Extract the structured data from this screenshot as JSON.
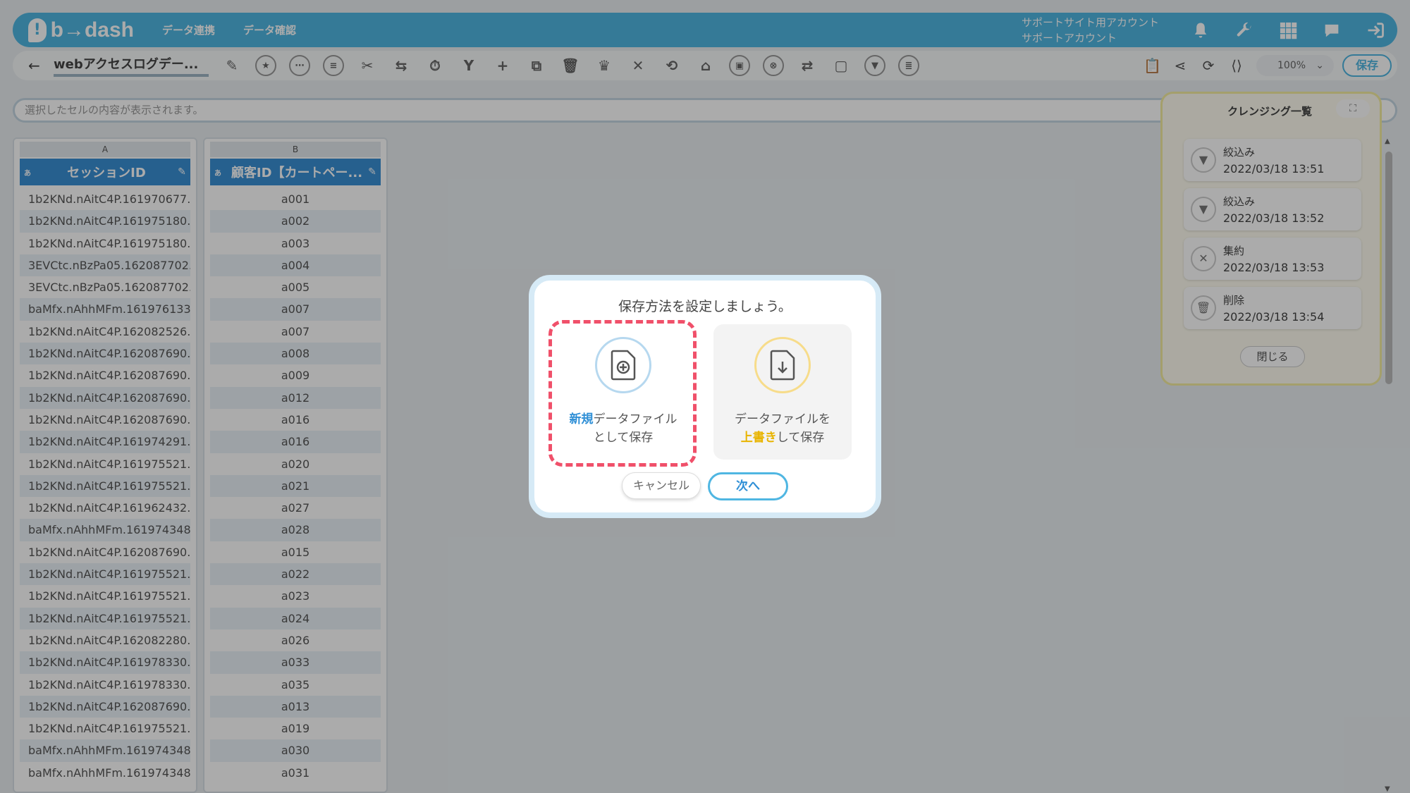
{
  "header": {
    "logo_mark": "!",
    "logo_text": "b→dash",
    "nav": [
      "データ連携",
      "データ確認"
    ],
    "account_line1": "サポートサイト用アカウント",
    "account_line2": "サポートアカウント"
  },
  "toolbar": {
    "back": "←",
    "title": "webアクセスログデー...",
    "zoom": "100%",
    "zoom_caret": "⌄",
    "save_label": "保存"
  },
  "cellbar": {
    "placeholder": "選択したセルの内容が表示されます。"
  },
  "grid": {
    "col_a": {
      "letter": "A",
      "type": "あ",
      "name": "セッションID"
    },
    "col_b": {
      "letter": "B",
      "type": "あ",
      "name": "顧客ID【カートペー..."
    },
    "rows_a": [
      "1b2KNd.nAitC4P.161970677...",
      "1b2KNd.nAitC4P.161975180...",
      "1b2KNd.nAitC4P.161975180...",
      "3EVCtc.nBzPa05.162087702...",
      "3EVCtc.nBzPa05.162087702...",
      "baMfx.nAhhMFm.161976133...",
      "1b2KNd.nAitC4P.162082526...",
      "1b2KNd.nAitC4P.162087690...",
      "1b2KNd.nAitC4P.162087690...",
      "1b2KNd.nAitC4P.162087690...",
      "1b2KNd.nAitC4P.162087690...",
      "1b2KNd.nAitC4P.161974291...",
      "1b2KNd.nAitC4P.161975521...",
      "1b2KNd.nAitC4P.161975521...",
      "1b2KNd.nAitC4P.161962432...",
      "baMfx.nAhhMFm.161974348...",
      "1b2KNd.nAitC4P.162087690...",
      "1b2KNd.nAitC4P.161975521...",
      "1b2KNd.nAitC4P.161975521...",
      "1b2KNd.nAitC4P.161975521...",
      "1b2KNd.nAitC4P.162082280...",
      "1b2KNd.nAitC4P.161978330...",
      "1b2KNd.nAitC4P.161978330...",
      "1b2KNd.nAitC4P.162087690...",
      "1b2KNd.nAitC4P.161975521...",
      "baMfx.nAhhMFm.161974348...",
      "baMfx.nAhhMFm.161974348..."
    ],
    "rows_b": [
      "a001",
      "a002",
      "a003",
      "a004",
      "a005",
      "a007",
      "a007",
      "a008",
      "a009",
      "a012",
      "a016",
      "a016",
      "a020",
      "a021",
      "a027",
      "a028",
      "a015",
      "a022",
      "a023",
      "a024",
      "a026",
      "a033",
      "a035",
      "a013",
      "a019",
      "a030",
      "a031"
    ]
  },
  "cleansing": {
    "title": "クレンジング一覧",
    "expand": "⛶",
    "items": [
      {
        "icon": "▼",
        "label": "絞込み",
        "time": "2022/03/18 13:51"
      },
      {
        "icon": "▼",
        "label": "絞込み",
        "time": "2022/03/18 13:52"
      },
      {
        "icon": "✕",
        "label": "集約",
        "time": "2022/03/18 13:53"
      },
      {
        "icon": "🗑",
        "label": "削除",
        "time": "2022/03/18 13:54"
      }
    ],
    "close_label": "閉じる"
  },
  "modal": {
    "title": "保存方法を設定しましょう。",
    "option_new": {
      "highlight": "新規",
      "line1_rest": "データファイル",
      "line2": "として保存"
    },
    "option_overwrite": {
      "line1": "データファイルを",
      "highlight": "上書き",
      "line2_rest": "して保存"
    },
    "cancel_label": "キャンセル",
    "next_label": "次へ"
  },
  "colors": {
    "accent": "#4fb6e2",
    "column_header": "#3a8fd4",
    "highlight_outline": "#f0506a",
    "overwrite_highlight": "#e8b400"
  }
}
